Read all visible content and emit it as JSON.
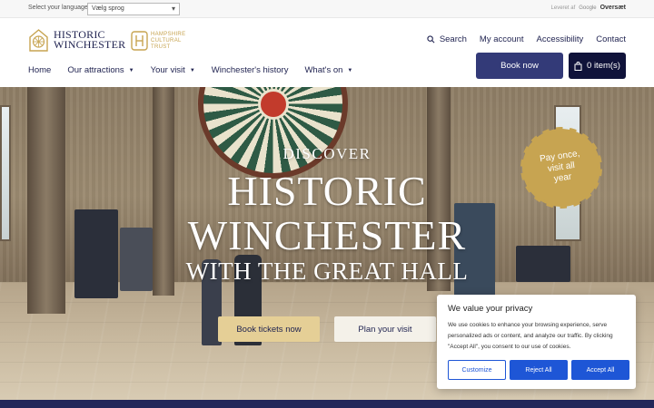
{
  "translate_bar": {
    "label": "Select your language:",
    "select_value": "Vælg sprog",
    "powered_by": "Leveret af",
    "google": "Google",
    "translate": "Oversæt"
  },
  "header": {
    "logo_main": "HISTORIC WINCHESTER",
    "logo_line1": "HISTORIC",
    "logo_line2": "WINCHESTER",
    "partner_line1": "HAMPSHIRE",
    "partner_line2": "CULTURAL",
    "partner_line3": "TRUST",
    "util_nav": {
      "search": "Search",
      "account": "My account",
      "accessibility": "Accessibility",
      "contact": "Contact"
    },
    "main_nav": [
      {
        "label": "Home",
        "has_dropdown": false
      },
      {
        "label": "Our attractions",
        "has_dropdown": true
      },
      {
        "label": "Your visit",
        "has_dropdown": true
      },
      {
        "label": "Winchester's history",
        "has_dropdown": false
      },
      {
        "label": "What's on",
        "has_dropdown": true
      }
    ],
    "book_now": "Book now",
    "cart": "0 item(s)"
  },
  "hero": {
    "discover": "DISCOVER",
    "title_line1": "HISTORIC",
    "title_line2": "WINCHESTER",
    "subtitle": "WITH THE GREAT HALL",
    "badge_line1": "Pay once,",
    "badge_line2": "visit all",
    "badge_line3": "year",
    "cta_primary": "Book tickets now",
    "cta_secondary": "Plan your visit"
  },
  "cookie_banner": {
    "title": "We value your privacy",
    "body": "We use cookies to enhance your browsing experience, serve personalized ads or content, and analyze our traffic. By clicking \"Accept All\", you consent to our use of cookies.",
    "customize": "Customize",
    "reject": "Reject All",
    "accept": "Accept All"
  },
  "colors": {
    "navy": "#333a78",
    "dark_navy": "#10133a",
    "gold": "#c7a451",
    "cookie_blue": "#1e56d6"
  }
}
